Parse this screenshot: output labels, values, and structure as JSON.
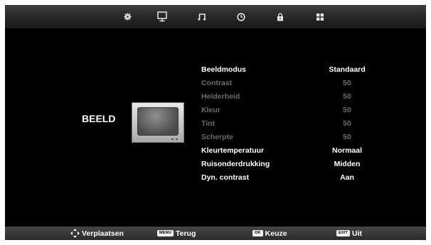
{
  "top_tabs": [
    {
      "icon": "gear-icon"
    },
    {
      "icon": "monitor-icon"
    },
    {
      "icon": "music-note-icon"
    },
    {
      "icon": "clock-icon"
    },
    {
      "icon": "lock-icon"
    },
    {
      "icon": "grid-icon"
    }
  ],
  "section": {
    "title": "BEELD"
  },
  "menu": [
    {
      "label": "Beeldmodus",
      "value": "Standaard",
      "enabled": true
    },
    {
      "label": "Contrast",
      "value": "50",
      "enabled": false
    },
    {
      "label": "Helderheid",
      "value": "50",
      "enabled": false
    },
    {
      "label": "Kleur",
      "value": "50",
      "enabled": false
    },
    {
      "label": "Tint",
      "value": "50",
      "enabled": false
    },
    {
      "label": "Scherpte",
      "value": "50",
      "enabled": false
    },
    {
      "label": "Kleurtemperatuur",
      "value": "Normaal",
      "enabled": true
    },
    {
      "label": "Ruisonderdrukking",
      "value": "Midden",
      "enabled": true
    },
    {
      "label": "Dyn. contrast",
      "value": "Aan",
      "enabled": true
    }
  ],
  "hints": {
    "move": {
      "label": "Verplaatsen",
      "icon": "dpad-arrows-icon"
    },
    "back": {
      "key": "MENU",
      "label": "Terug"
    },
    "ok": {
      "key": "OK",
      "label": "Keuze"
    },
    "exit": {
      "key": "EXIT",
      "label": "Uit"
    }
  },
  "colors": {
    "active_text": "#ffffff",
    "disabled_text": "#6b6b6b",
    "background": "#000000"
  }
}
